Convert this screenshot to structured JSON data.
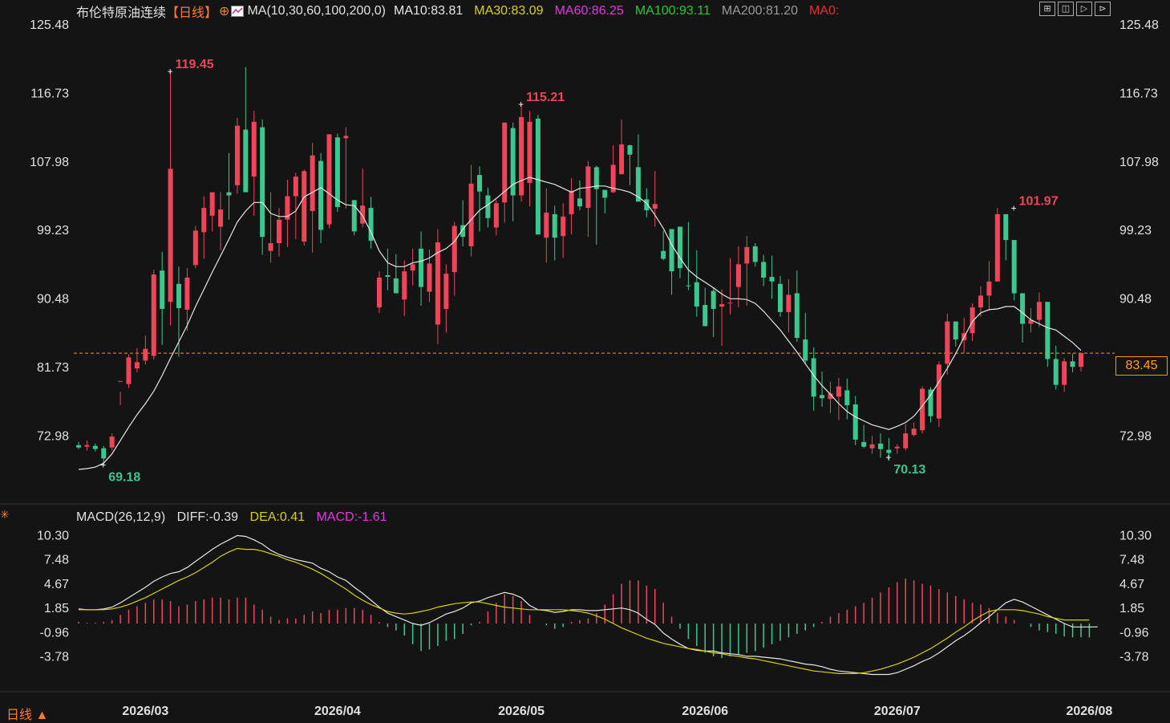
{
  "header": {
    "title": "布伦特原油连续",
    "period": "【日线】",
    "period_icon": "⊕",
    "ma_label": "MA(10,30,60,100,200,0)",
    "ma_values": [
      {
        "label": "MA10:83.81",
        "color": "#e6e6e6"
      },
      {
        "label": "MA30:83.09",
        "color": "#d7d200"
      },
      {
        "label": "MA60:86.25",
        "color": "#e633e6"
      },
      {
        "label": "MA100:93.11",
        "color": "#22cc22"
      },
      {
        "label": "MA200:81.20",
        "color": "#9a9a9a"
      },
      {
        "label": "MA0:",
        "color": "#e03030"
      }
    ],
    "toolbar_icons": [
      "crosshair-icon",
      "panel-icon",
      "play-icon",
      "next-icon"
    ]
  },
  "macd_header": {
    "label": "MACD(26,12,9)",
    "diff": "DIFF:-0.39",
    "dea": "DEA:0.41",
    "macd": "MACD:-1.61"
  },
  "footer": {
    "period": "日线 ▲"
  },
  "current_price": "83.45",
  "colors": {
    "up": "#f0445a",
    "down": "#3cc78e",
    "ma10": "#e6e6e6",
    "ma30": "#d7d200",
    "ma60": "#e633e6",
    "ma100": "#22cc22",
    "ma200": "#9a9a9a",
    "price_line": "#ff9800"
  },
  "chart_data": [
    {
      "type": "candlestick",
      "title": "布伦特原油连续",
      "ylim": [
        64.5,
        125.48
      ],
      "y_ticks": [
        "125.48",
        "116.73",
        "107.98",
        "99.23",
        "90.48",
        "81.73",
        "72.98"
      ],
      "x_ticks": [
        "2026/03",
        "2026/04",
        "2026/05",
        "2026/06",
        "2026/07",
        "2026/08"
      ],
      "x_tick_index": [
        8,
        31,
        53,
        75,
        98,
        121
      ],
      "annotations": [
        {
          "label": "119.45",
          "index": 11,
          "value": 119.45,
          "kind": "high"
        },
        {
          "label": "69.18",
          "index": 3,
          "value": 69.18,
          "kind": "low"
        },
        {
          "label": "115.21",
          "index": 53,
          "value": 115.21,
          "kind": "high"
        },
        {
          "label": "70.13",
          "index": 97,
          "value": 70.13,
          "kind": "low"
        },
        {
          "label": "101.97",
          "index": 112,
          "value": 101.97,
          "kind": "high"
        }
      ],
      "ohlc": [
        [
          71.7,
          72.1,
          71.2,
          71.4
        ],
        [
          71.5,
          72.3,
          71.0,
          71.7
        ],
        [
          71.6,
          71.9,
          70.9,
          71.2
        ],
        [
          71.3,
          71.6,
          69.2,
          70.0
        ],
        [
          71.4,
          73.2,
          71.0,
          72.8
        ],
        [
          79.8,
          78.5,
          76.8,
          79.9
        ],
        [
          79.5,
          83.3,
          79.0,
          82.9
        ],
        [
          81.5,
          84.1,
          81.0,
          82.3
        ],
        [
          82.5,
          85.7,
          82.0,
          84.0
        ],
        [
          83.1,
          94.1,
          82.6,
          93.5
        ],
        [
          94.0,
          96.4,
          84.5,
          89.1
        ],
        [
          90.0,
          119.5,
          87.0,
          107.0
        ],
        [
          92.3,
          94.5,
          83.0,
          89.2
        ],
        [
          89.0,
          94.3,
          86.3,
          93.1
        ],
        [
          94.7,
          99.7,
          94.3,
          99.1
        ],
        [
          98.9,
          103.5,
          95.5,
          102.0
        ],
        [
          101.0,
          103.3,
          99.0,
          104.0
        ],
        [
          99.6,
          104.0,
          96.6,
          101.8
        ],
        [
          104.0,
          109.0,
          100.5,
          103.6
        ],
        [
          104.9,
          113.5,
          103.8,
          112.5
        ],
        [
          112.0,
          120.0,
          107.0,
          104.0
        ],
        [
          106.0,
          114.4,
          101.0,
          113.0
        ],
        [
          112.3,
          113.3,
          96.0,
          98.3
        ],
        [
          96.5,
          104.0,
          95.0,
          97.5
        ],
        [
          97.5,
          102.0,
          95.8,
          100.5
        ],
        [
          100.5,
          105.6,
          97.0,
          103.5
        ],
        [
          103.5,
          106.5,
          98.0,
          106.0
        ],
        [
          97.7,
          106.9,
          97.2,
          106.7
        ],
        [
          101.6,
          110.3,
          96.3,
          108.7
        ],
        [
          108.0,
          109.0,
          97.5,
          99.2
        ],
        [
          99.9,
          111.4,
          99.4,
          111.4
        ],
        [
          111.0,
          111.5,
          101.5,
          102.1
        ],
        [
          110.9,
          112.3,
          101.9,
          111.2
        ],
        [
          103.0,
          103.0,
          98.5,
          99.0
        ],
        [
          100.0,
          107.0,
          99.5,
          102.3
        ],
        [
          102.0,
          103.4,
          96.8,
          97.8
        ],
        [
          89.3,
          93.9,
          88.6,
          93.1
        ],
        [
          93.4,
          96.8,
          91.5,
          93.2
        ],
        [
          93.0,
          96.1,
          91.9,
          91.1
        ],
        [
          90.3,
          95.3,
          88.2,
          93.9
        ],
        [
          94.0,
          96.8,
          92.1,
          94.8
        ],
        [
          96.8,
          99.0,
          89.5,
          91.9
        ],
        [
          91.3,
          96.7,
          90.0,
          94.9
        ],
        [
          87.1,
          99.3,
          84.6,
          97.6
        ],
        [
          89.1,
          94.8,
          86.1,
          93.6
        ],
        [
          93.8,
          100.2,
          90.8,
          99.7
        ],
        [
          99.8,
          103.0,
          97.1,
          98.3
        ],
        [
          97.1,
          107.5,
          95.8,
          105.1
        ],
        [
          106.2,
          107.3,
          99.0,
          104.1
        ],
        [
          103.6,
          104.6,
          99.5,
          100.7
        ],
        [
          99.5,
          103.0,
          98.5,
          102.6
        ],
        [
          102.7,
          110.8,
          100.1,
          112.9
        ],
        [
          112.2,
          112.9,
          100.3,
          103.6
        ],
        [
          103.6,
          115.2,
          102.8,
          113.6
        ],
        [
          105.2,
          114.4,
          102.2,
          113.0
        ],
        [
          113.4,
          113.9,
          103.3,
          98.6
        ],
        [
          98.2,
          104.5,
          95.0,
          101.4
        ],
        [
          101.2,
          102.3,
          95.3,
          98.2
        ],
        [
          98.4,
          102.6,
          95.6,
          100.9
        ],
        [
          101.2,
          105.8,
          98.6,
          104.2
        ],
        [
          103.2,
          105.5,
          101.7,
          102.2
        ],
        [
          102.0,
          108.0,
          98.3,
          107.3
        ],
        [
          107.2,
          107.4,
          97.3,
          104.4
        ],
        [
          104.3,
          104.2,
          101.3,
          103.3
        ],
        [
          104.0,
          110.0,
          103.9,
          107.5
        ],
        [
          106.3,
          113.3,
          106.7,
          110.1
        ],
        [
          110.0,
          110.1,
          104.9,
          108.8
        ],
        [
          107.2,
          111.4,
          104.0,
          102.8
        ],
        [
          103.1,
          104.5,
          100.8,
          101.7
        ],
        [
          101.9,
          106.7,
          99.6,
          102.5
        ],
        [
          96.5,
          99.1,
          95.3,
          95.5
        ],
        [
          99.3,
          97.6,
          90.9,
          93.9
        ],
        [
          99.6,
          97.3,
          93.0,
          94.3
        ],
        [
          92.1,
          100.2,
          91.5,
          92.0
        ],
        [
          92.5,
          96.6,
          88.1,
          89.4
        ],
        [
          89.6,
          91.8,
          88.4,
          86.9
        ],
        [
          91.4,
          91.8,
          85.5,
          89.1
        ],
        [
          89.4,
          91.6,
          84.4,
          89.7
        ],
        [
          89.9,
          95.6,
          88.4,
          89.9
        ],
        [
          91.9,
          97.1,
          89.3,
          94.8
        ],
        [
          94.9,
          98.4,
          89.5,
          97.0
        ],
        [
          97.1,
          97.5,
          94.5,
          95.1
        ],
        [
          95.1,
          96.0,
          92.0,
          93.1
        ],
        [
          93.2,
          95.9,
          90.4,
          92.6
        ],
        [
          92.3,
          93.3,
          88.1,
          88.7
        ],
        [
          88.7,
          92.9,
          86.1,
          90.9
        ],
        [
          91.1,
          94.0,
          84.9,
          85.4
        ],
        [
          85.2,
          88.6,
          82.1,
          82.5
        ],
        [
          82.8,
          84.2,
          76.1,
          77.9
        ],
        [
          78.1,
          81.1,
          76.6,
          77.7
        ],
        [
          77.6,
          79.8,
          75.8,
          78.3
        ],
        [
          77.9,
          80.3,
          74.9,
          79.2
        ],
        [
          78.7,
          80.2,
          75.0,
          76.8
        ],
        [
          76.9,
          78.0,
          71.7,
          72.4
        ],
        [
          72.1,
          74.3,
          71.3,
          71.5
        ],
        [
          71.3,
          72.9,
          70.6,
          71.8
        ],
        [
          71.9,
          73.2,
          70.1,
          71.2
        ],
        [
          71.1,
          72.6,
          69.7,
          70.7
        ],
        [
          71.3,
          71.8,
          70.6,
          71.5
        ],
        [
          71.3,
          74.4,
          71.0,
          73.2
        ],
        [
          73.0,
          74.6,
          72.8,
          73.8
        ],
        [
          73.6,
          79.2,
          73.2,
          78.9
        ],
        [
          78.8,
          79.1,
          74.6,
          75.4
        ],
        [
          75.1,
          82.4,
          74.0,
          82.0
        ],
        [
          82.1,
          88.5,
          80.7,
          87.5
        ],
        [
          87.5,
          87.4,
          84.3,
          85.2
        ],
        [
          85.1,
          88.0,
          83.5,
          86.0
        ],
        [
          86.0,
          89.8,
          85.0,
          89.3
        ],
        [
          89.3,
          92.0,
          88.1,
          90.8
        ],
        [
          90.8,
          95.2,
          89.0,
          92.6
        ],
        [
          92.6,
          102.0,
          92.7,
          101.2
        ],
        [
          101.2,
          100.7,
          95.3,
          97.9
        ],
        [
          97.9,
          93.3,
          90.2,
          91.1
        ],
        [
          91.1,
          90.0,
          84.8,
          87.2
        ],
        [
          87.2,
          89.2,
          86.1,
          87.7
        ],
        [
          87.7,
          91.2,
          86.8,
          90.0
        ],
        [
          90.0,
          84.2,
          81.7,
          82.7
        ],
        [
          82.7,
          84.4,
          78.8,
          79.4
        ],
        [
          79.4,
          82.8,
          78.5,
          82.4
        ],
        [
          82.4,
          83.4,
          81.0,
          81.7
        ],
        [
          81.7,
          83.5,
          81.1,
          83.45
        ]
      ],
      "ma_series": {
        "MA10": [
          68.6,
          68.7,
          68.9,
          69.4,
          70.6,
          72.3,
          74.0,
          75.6,
          77.0,
          78.6,
          80.6,
          82.8,
          84.9,
          87.0,
          89.4,
          91.6,
          93.8,
          95.9,
          98.0,
          100.2,
          101.6,
          102.7,
          102.7,
          101.3,
          100.9,
          100.9,
          101.6,
          103.4,
          104.0,
          104.6,
          103.8,
          103.0,
          102.4,
          102.3,
          101.0,
          98.9,
          96.5,
          95.0,
          94.5,
          94.5,
          95.0,
          95.2,
          95.6,
          96.3,
          96.8,
          97.7,
          99.3,
          100.5,
          101.7,
          102.4,
          103.2,
          104.1,
          105.0,
          105.5,
          105.9,
          105.6,
          105.3,
          105.0,
          104.5,
          104.0,
          104.5,
          104.6,
          104.8,
          104.8,
          104.5,
          104.3,
          104.0,
          103.4,
          102.6,
          101.1,
          99.4,
          97.3,
          95.6,
          94.1,
          93.2,
          92.5,
          91.8,
          91.0,
          90.4,
          90.4,
          90.3,
          89.8,
          88.8,
          87.6,
          86.4,
          85.0,
          83.6,
          82.1,
          80.6,
          79.3,
          78.2,
          77.0,
          76.0,
          75.3,
          74.8,
          74.3,
          74.0,
          73.7,
          74.1,
          74.6,
          75.4,
          76.7,
          78.1,
          79.8,
          81.5,
          83.4,
          85.5,
          87.5,
          88.6,
          89.0,
          89.1,
          89.4,
          89.4,
          88.6,
          87.7,
          87.2,
          86.7,
          86.4,
          85.6,
          84.8,
          83.8
        ]
      }
    },
    {
      "type": "macd",
      "title": "MACD(26,12,9)",
      "ylim": [
        -6.6,
        10.7
      ],
      "y_ticks": [
        "10.30",
        "7.48",
        "4.67",
        "1.85",
        "-0.96",
        "-3.78"
      ],
      "diff": [
        1.7,
        1.6,
        1.6,
        1.7,
        1.9,
        2.4,
        3.0,
        3.6,
        4.2,
        4.9,
        5.4,
        5.8,
        6.0,
        6.5,
        7.2,
        7.9,
        8.6,
        9.2,
        9.7,
        10.2,
        10.1,
        9.7,
        9.2,
        8.5,
        8.0,
        7.7,
        7.4,
        7.2,
        7.0,
        6.4,
        6.0,
        5.4,
        5.0,
        4.2,
        3.5,
        2.7,
        1.9,
        1.2,
        0.8,
        0.4,
        0.0,
        -0.2,
        0.1,
        0.6,
        1.1,
        1.4,
        1.8,
        2.4,
        2.6,
        3.0,
        3.3,
        3.6,
        3.4,
        3.0,
        2.1,
        1.6,
        1.5,
        1.3,
        1.4,
        1.6,
        1.6,
        1.5,
        1.5,
        1.6,
        1.7,
        1.8,
        1.6,
        1.2,
        0.5,
        -0.1,
        -1.1,
        -1.8,
        -2.4,
        -2.9,
        -3.1,
        -3.2,
        -3.2,
        -3.4,
        -3.5,
        -3.6,
        -3.8,
        -3.8,
        -3.9,
        -4.0,
        -4.1,
        -4.3,
        -4.5,
        -4.7,
        -4.8,
        -5.0,
        -5.3,
        -5.5,
        -5.6,
        -5.7,
        -5.8,
        -5.9,
        -5.9,
        -5.9,
        -5.7,
        -5.3,
        -4.9,
        -4.4,
        -4.0,
        -3.4,
        -2.7,
        -2.0,
        -1.4,
        -0.7,
        0.1,
        0.8,
        1.6,
        2.4,
        2.8,
        2.5,
        2.0,
        1.5,
        1.0,
        0.5,
        0.0,
        -0.4,
        -0.4,
        -0.4,
        -0.39
      ],
      "dea": [
        1.6,
        1.6,
        1.6,
        1.6,
        1.7,
        1.9,
        2.2,
        2.6,
        3.0,
        3.5,
        4.0,
        4.5,
        5.0,
        5.4,
        5.9,
        6.5,
        7.1,
        7.8,
        8.3,
        8.7,
        8.6,
        8.6,
        8.4,
        8.1,
        7.8,
        7.4,
        7.1,
        6.7,
        6.3,
        5.8,
        5.2,
        4.6,
        4.0,
        3.3,
        2.7,
        2.2,
        1.8,
        1.4,
        1.2,
        1.1,
        1.2,
        1.4,
        1.6,
        1.9,
        2.1,
        2.3,
        2.4,
        2.5,
        2.5,
        2.3,
        2.1,
        1.9,
        1.8,
        1.7,
        1.6,
        1.6,
        1.6,
        1.6,
        1.6,
        1.5,
        1.4,
        1.2,
        0.9,
        0.5,
        0.0,
        -0.5,
        -0.9,
        -1.3,
        -1.7,
        -2.0,
        -2.3,
        -2.5,
        -2.7,
        -2.9,
        -3.0,
        -3.2,
        -3.4,
        -3.5,
        -3.7,
        -3.8,
        -4.0,
        -4.1,
        -4.3,
        -4.5,
        -4.7,
        -4.9,
        -5.1,
        -5.3,
        -5.5,
        -5.6,
        -5.7,
        -5.8,
        -5.8,
        -5.8,
        -5.7,
        -5.5,
        -5.3,
        -5.0,
        -4.7,
        -4.3,
        -3.9,
        -3.4,
        -2.9,
        -2.3,
        -1.7,
        -1.0,
        -0.4,
        0.3,
        0.9,
        1.4,
        1.6,
        1.6,
        1.6,
        1.5,
        1.3,
        1.1,
        0.8,
        0.6,
        0.41,
        0.41,
        0.41,
        0.41
      ],
      "macd_hist": [
        0.2,
        0.1,
        0.1,
        0.2,
        0.4,
        1.0,
        1.6,
        2.0,
        2.4,
        2.8,
        2.8,
        2.6,
        2.0,
        2.2,
        2.6,
        2.8,
        3.0,
        3.0,
        2.8,
        3.0,
        3.0,
        2.2,
        1.6,
        0.8,
        0.4,
        0.6,
        0.6,
        1.0,
        1.4,
        1.2,
        1.6,
        1.6,
        1.8,
        1.8,
        1.6,
        1.0,
        0.2,
        -0.4,
        -0.8,
        -1.4,
        -2.4,
        -3.2,
        -3.0,
        -2.6,
        -2.0,
        -1.8,
        -1.2,
        -0.2,
        0.2,
        1.4,
        2.4,
        3.4,
        3.2,
        2.6,
        1.0,
        0.0,
        -0.2,
        -0.6,
        -0.4,
        0.2,
        0.4,
        0.6,
        1.2,
        2.2,
        3.4,
        4.6,
        5.0,
        5.0,
        4.4,
        4.0,
        2.4,
        0.8,
        -0.6,
        -1.8,
        -2.6,
        -3.4,
        -3.8,
        -4.0,
        -3.8,
        -3.6,
        -3.4,
        -3.2,
        -2.8,
        -2.4,
        -2.0,
        -1.6,
        -1.2,
        -0.8,
        -0.4,
        0.2,
        0.8,
        1.2,
        1.6,
        2.0,
        2.4,
        3.0,
        3.6,
        4.2,
        4.8,
        5.2,
        5.0,
        4.6,
        4.4,
        4.0,
        3.6,
        3.2,
        2.8,
        2.4,
        2.2,
        1.8,
        1.2,
        0.8,
        0.4,
        0.0,
        -0.4,
        -0.8,
        -1.0,
        -1.2,
        -1.5,
        -1.6,
        -1.6,
        -1.61
      ]
    }
  ]
}
